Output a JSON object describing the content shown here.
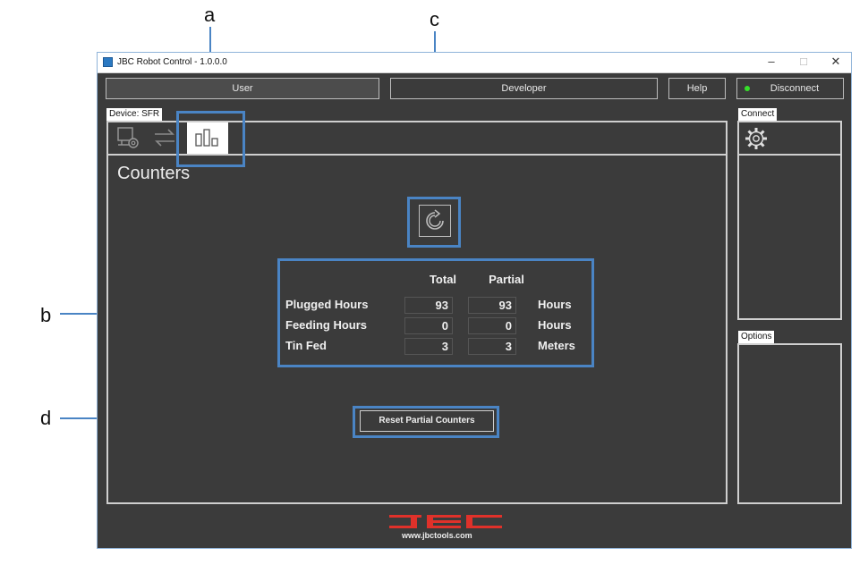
{
  "window": {
    "title": "JBC Robot Control - 1.0.0.0",
    "controls": {
      "minimize": "–",
      "maximize": "□",
      "close": "✕"
    }
  },
  "toolbar": {
    "user_label": "User",
    "developer_label": "Developer",
    "help_label": "Help",
    "disconnect_label": "Disconnect",
    "status_color": "#36e02a"
  },
  "device": {
    "tag": "Device: SFR",
    "tabs": [
      {
        "name": "settings-station-icon"
      },
      {
        "name": "transfer-arrows-icon"
      },
      {
        "name": "counters-bars-icon",
        "selected": true
      }
    ]
  },
  "counters": {
    "title": "Counters",
    "refresh_icon": "refresh-icon",
    "headers": {
      "total": "Total",
      "partial": "Partial"
    },
    "rows": [
      {
        "label": "Plugged Hours",
        "total": "93",
        "partial": "93",
        "unit": "Hours"
      },
      {
        "label": "Feeding Hours",
        "total": "0",
        "partial": "0",
        "unit": "Hours"
      },
      {
        "label": "Tin Fed",
        "total": "3",
        "partial": "3",
        "unit": "Meters"
      }
    ],
    "reset_label": "Reset Partial Counters"
  },
  "side": {
    "connect_label": "Connect",
    "options_label": "Options",
    "gear_icon": "gear-icon"
  },
  "footer": {
    "logo": "JBC",
    "url": "www.jbctools.com",
    "logo_color": "#e0312a"
  },
  "callouts": {
    "a": "a",
    "b": "b",
    "c": "c",
    "d": "d"
  },
  "accent": "#4a84c4"
}
